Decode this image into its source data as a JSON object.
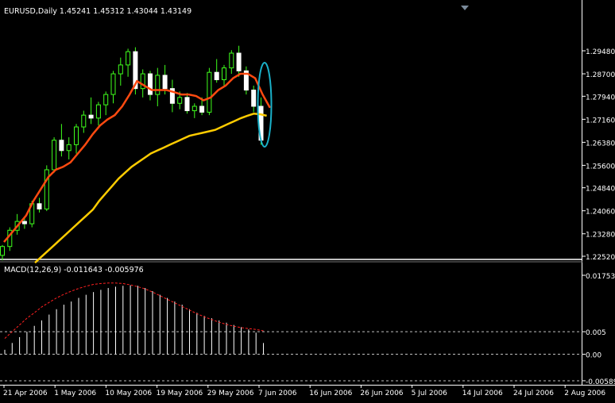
{
  "colors": {
    "background": "#000000",
    "axis": "#ffffff",
    "bull_candle": "#3fff1c",
    "bear_candle": "#ffffff",
    "fast_ma": "#ff4a10",
    "slow_ma": "#ffcc00",
    "highlight": "#1ab0c8",
    "macd_hist": "#ffffff",
    "macd_signal": "#ff2020",
    "level_line": "#c0c0c0"
  },
  "chart_data": [
    {
      "type": "candlestick",
      "title": "EURUSD,Daily  1.45241 1.45312 1.43044 1.43149",
      "ylim": [
        1.2252,
        1.3026
      ],
      "y_ticks": [
        "1.29480",
        "1.28700",
        "1.27940",
        "1.27160",
        "1.26380",
        "1.25600",
        "1.24840",
        "1.24060",
        "1.23280",
        "1.22520"
      ],
      "x_ticks": [
        "21 Apr 2006",
        "1 May 2006",
        "10 May 2006",
        "19 May 2006",
        "29 May 2006",
        "7 Jun 2006",
        "16 Jun 2006",
        "26 Jun 2006",
        "5 Jul 2006",
        "14 Jul 2006",
        "24 Jul 2006",
        "2 Aug 2006"
      ],
      "bars": [
        {
          "o": 1.2255,
          "h": 1.229,
          "l": 1.2238,
          "c": 1.2285
        },
        {
          "o": 1.2285,
          "h": 1.235,
          "l": 1.227,
          "c": 1.234
        },
        {
          "o": 1.234,
          "h": 1.2395,
          "l": 1.2325,
          "c": 1.237
        },
        {
          "o": 1.237,
          "h": 1.238,
          "l": 1.2345,
          "c": 1.2362
        },
        {
          "o": 1.2362,
          "h": 1.244,
          "l": 1.235,
          "c": 1.243
        },
        {
          "o": 1.243,
          "h": 1.245,
          "l": 1.24,
          "c": 1.2412
        },
        {
          "o": 1.2412,
          "h": 1.256,
          "l": 1.2405,
          "c": 1.2545
        },
        {
          "o": 1.2545,
          "h": 1.2655,
          "l": 1.2535,
          "c": 1.2645
        },
        {
          "o": 1.2645,
          "h": 1.27,
          "l": 1.259,
          "c": 1.261
        },
        {
          "o": 1.261,
          "h": 1.2655,
          "l": 1.258,
          "c": 1.263
        },
        {
          "o": 1.263,
          "h": 1.27,
          "l": 1.26,
          "c": 1.269
        },
        {
          "o": 1.269,
          "h": 1.2745,
          "l": 1.267,
          "c": 1.273
        },
        {
          "o": 1.273,
          "h": 1.279,
          "l": 1.27,
          "c": 1.272
        },
        {
          "o": 1.272,
          "h": 1.2775,
          "l": 1.2695,
          "c": 1.2765
        },
        {
          "o": 1.2765,
          "h": 1.281,
          "l": 1.273,
          "c": 1.28
        },
        {
          "o": 1.28,
          "h": 1.288,
          "l": 1.277,
          "c": 1.287
        },
        {
          "o": 1.287,
          "h": 1.2925,
          "l": 1.283,
          "c": 1.29
        },
        {
          "o": 1.29,
          "h": 1.2955,
          "l": 1.286,
          "c": 1.2945
        },
        {
          "o": 1.2945,
          "h": 1.296,
          "l": 1.28,
          "c": 1.282
        },
        {
          "o": 1.282,
          "h": 1.2885,
          "l": 1.279,
          "c": 1.287
        },
        {
          "o": 1.287,
          "h": 1.288,
          "l": 1.278,
          "c": 1.28
        },
        {
          "o": 1.28,
          "h": 1.289,
          "l": 1.276,
          "c": 1.2865
        },
        {
          "o": 1.2865,
          "h": 1.29,
          "l": 1.28,
          "c": 1.282
        },
        {
          "o": 1.282,
          "h": 1.285,
          "l": 1.274,
          "c": 1.277
        },
        {
          "o": 1.277,
          "h": 1.281,
          "l": 1.275,
          "c": 1.279
        },
        {
          "o": 1.279,
          "h": 1.2805,
          "l": 1.2735,
          "c": 1.2745
        },
        {
          "o": 1.2745,
          "h": 1.277,
          "l": 1.272,
          "c": 1.276
        },
        {
          "o": 1.276,
          "h": 1.279,
          "l": 1.273,
          "c": 1.274
        },
        {
          "o": 1.274,
          "h": 1.289,
          "l": 1.273,
          "c": 1.2875
        },
        {
          "o": 1.2875,
          "h": 1.292,
          "l": 1.284,
          "c": 1.285
        },
        {
          "o": 1.285,
          "h": 1.29,
          "l": 1.283,
          "c": 1.289
        },
        {
          "o": 1.289,
          "h": 1.295,
          "l": 1.287,
          "c": 1.294
        },
        {
          "o": 1.294,
          "h": 1.2965,
          "l": 1.286,
          "c": 1.288
        },
        {
          "o": 1.288,
          "h": 1.2895,
          "l": 1.28,
          "c": 1.2815
        },
        {
          "o": 1.2815,
          "h": 1.283,
          "l": 1.274,
          "c": 1.276
        },
        {
          "o": 1.276,
          "h": 1.279,
          "l": 1.263,
          "c": 1.2645
        }
      ],
      "ma_fast": [
        1.23,
        1.233,
        1.236,
        1.239,
        1.244,
        1.248,
        1.252,
        1.2545,
        1.2555,
        1.257,
        1.26,
        1.263,
        1.2665,
        1.2695,
        1.2715,
        1.273,
        1.276,
        1.28,
        1.2845,
        1.283,
        1.2815,
        1.2815,
        1.2815,
        1.2808,
        1.28,
        1.28,
        1.2795,
        1.278,
        1.279,
        1.2815,
        1.283,
        1.2855,
        1.287,
        1.287,
        1.2855,
        1.28,
        1.2755
      ],
      "ma_slow": [
        1.223,
        1.225,
        1.227,
        1.229,
        1.231,
        1.233,
        1.235,
        1.237,
        1.239,
        1.241,
        1.244,
        1.2465,
        1.249,
        1.2515,
        1.2535,
        1.2555,
        1.257,
        1.2585,
        1.26,
        1.261,
        1.262,
        1.263,
        1.264,
        1.265,
        1.266,
        1.2665,
        1.267,
        1.2675,
        1.268,
        1.269,
        1.27,
        1.271,
        1.272,
        1.2728,
        1.2735,
        1.2733,
        1.2728
      ]
    },
    {
      "type": "bar",
      "title": "MACD(12,26,9) -0.011643 -0.005976",
      "ylim": [
        -0.0059,
        0.01753
      ],
      "y_ticks": [
        "0.01753",
        "0.005",
        "0.00",
        "-0.00589"
      ],
      "histogram": [
        0.001,
        0.0025,
        0.0038,
        0.005,
        0.0063,
        0.0075,
        0.0088,
        0.01,
        0.011,
        0.0117,
        0.0125,
        0.0132,
        0.0138,
        0.0143,
        0.0147,
        0.015,
        0.0152,
        0.0153,
        0.0152,
        0.0147,
        0.014,
        0.0132,
        0.0125,
        0.0117,
        0.011,
        0.01,
        0.0092,
        0.0085,
        0.008,
        0.0075,
        0.007,
        0.0065,
        0.006,
        0.0055,
        0.0048,
        0.0025
      ],
      "signal": [
        0.0035,
        0.005,
        0.0065,
        0.008,
        0.0092,
        0.0105,
        0.0115,
        0.0125,
        0.0133,
        0.014,
        0.0146,
        0.0151,
        0.0155,
        0.0157,
        0.0158,
        0.0158,
        0.0157,
        0.0154,
        0.015,
        0.0145,
        0.0138,
        0.013,
        0.0122,
        0.0114,
        0.0106,
        0.0098,
        0.009,
        0.0083,
        0.0077,
        0.0071,
        0.0066,
        0.0062,
        0.0059,
        0.0057,
        0.0055,
        0.0052
      ]
    }
  ]
}
